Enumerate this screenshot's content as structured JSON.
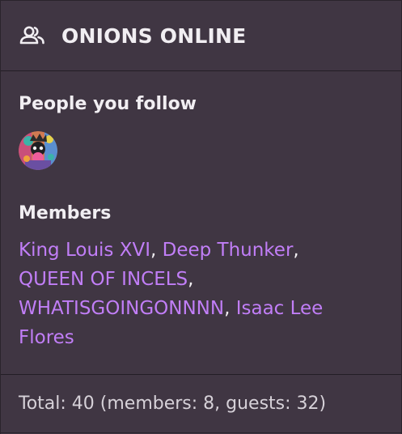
{
  "header": {
    "icon": "users-icon",
    "title": "ONIONS ONLINE"
  },
  "follow": {
    "title": "People you follow",
    "avatars": [
      {
        "icon": "avatar-image"
      }
    ]
  },
  "members": {
    "title": "Members",
    "list": [
      "King Louis XVI",
      "Deep Thunker",
      "QUEEN OF INCELS",
      "WHATISGOINGONNNN",
      "Isaac Lee Flores"
    ],
    "separator": ", ",
    "link_color": "#c17ef7"
  },
  "footer": {
    "total_text": "Total: 40 (members: 8, guests: 32)"
  }
}
